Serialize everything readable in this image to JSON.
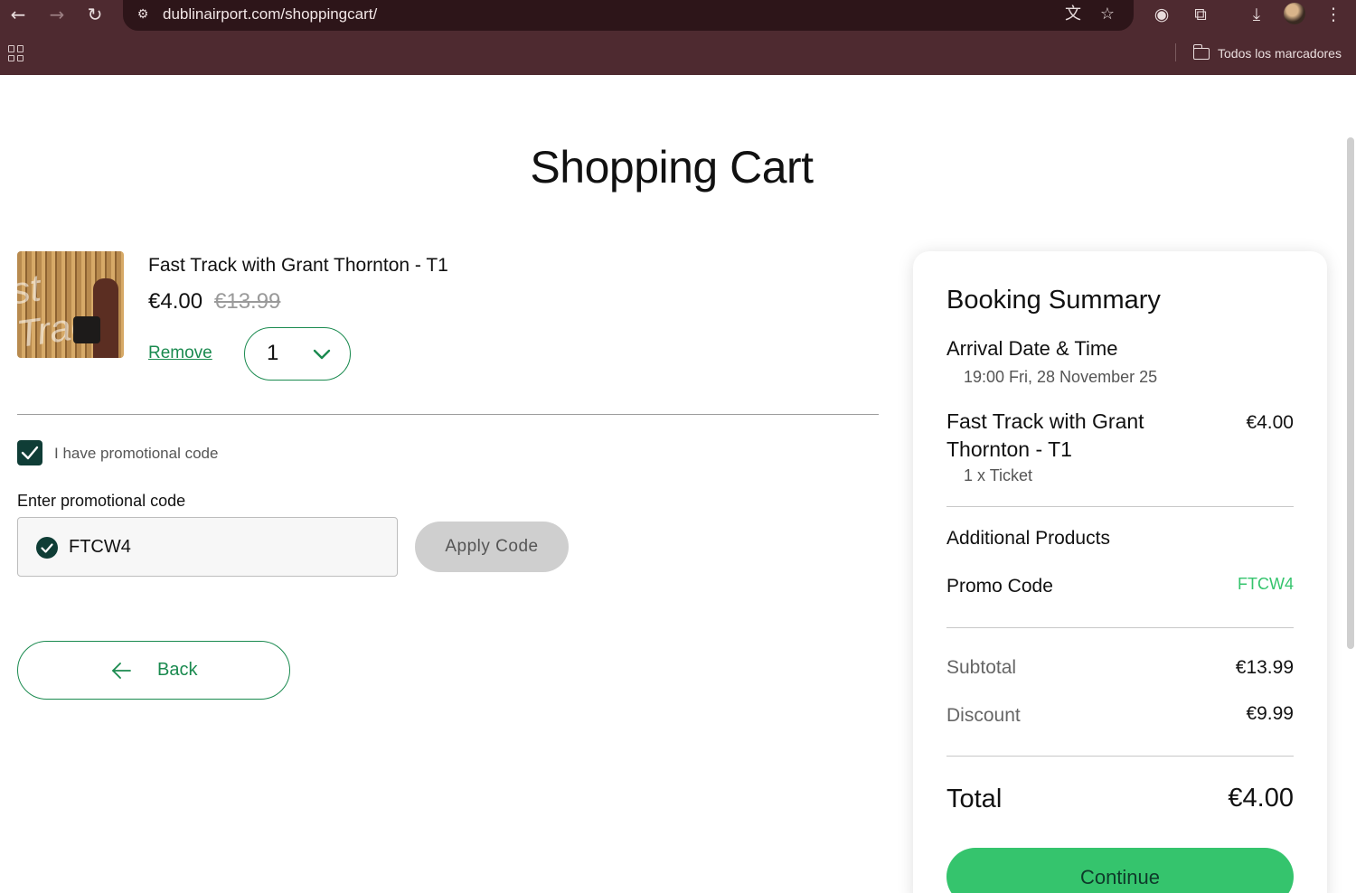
{
  "browser": {
    "url": "dublinairport.com/shoppingcart/",
    "bookmarks_label": "Todos los marcadores",
    "icons": [
      "back-icon",
      "forward-icon",
      "reload-icon",
      "site-info-icon",
      "translate-icon",
      "star-icon",
      "extension-c-icon",
      "puzzle-icon",
      "download-icon",
      "avatar",
      "menu-icon",
      "apps-icon",
      "folder-icon"
    ]
  },
  "page": {
    "title": "Shopping Cart"
  },
  "cart_item": {
    "name": "Fast Track with Grant Thornton - T1",
    "price": "€4.00",
    "original_price": "€13.99",
    "remove_label": "Remove",
    "quantity": "1"
  },
  "promo": {
    "checkbox_label": "I have promotional code",
    "checked": true,
    "field_label": "Enter promotional code",
    "code": "FTCW4",
    "apply_label": "Apply Code"
  },
  "back_label": "Back",
  "summary": {
    "title": "Booking Summary",
    "arrival_label": "Arrival Date & Time",
    "arrival_value": "19:00 Fri, 28 November 25",
    "item_name": "Fast Track with Grant Thornton - T1",
    "item_price": "€4.00",
    "item_qty": "1 x Ticket",
    "additional_label": "Additional Products",
    "promo_label": "Promo Code",
    "promo_value": "FTCW4",
    "subtotal_label": "Subtotal",
    "subtotal_value": "€13.99",
    "discount_label": "Discount",
    "discount_value": "€9.99",
    "total_label": "Total",
    "total_value": "€4.00",
    "continue_label": "Continue"
  },
  "colors": {
    "chrome_bg": "#4e2a30",
    "accent_green": "#1a8a4f",
    "button_green": "#35c46d",
    "checkbox_dark": "#0f3d36",
    "disabled_gray": "#cfcfcf"
  }
}
